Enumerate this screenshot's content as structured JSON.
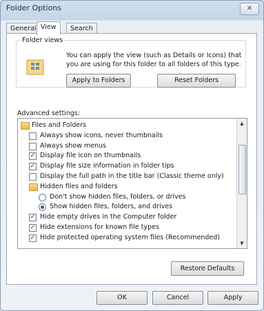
{
  "window": {
    "title": "Folder Options",
    "close_glyph": "✕"
  },
  "tabs": [
    {
      "label": "General"
    },
    {
      "label": "View"
    },
    {
      "label": "Search"
    }
  ],
  "folder_views": {
    "legend": "Folder views",
    "description": "You can apply the view (such as Details or Icons) that you are using for this folder to all folders of this type.",
    "apply_button": "Apply to Folders",
    "reset_button": "Reset Folders"
  },
  "advanced": {
    "label": "Advanced settings:",
    "items": [
      {
        "type": "folder",
        "label": "Files and Folders",
        "level": 0
      },
      {
        "type": "checkbox",
        "label": "Always show icons, never thumbnails",
        "checked": false,
        "level": 1
      },
      {
        "type": "checkbox",
        "label": "Always show menus",
        "checked": false,
        "level": 1
      },
      {
        "type": "checkbox",
        "label": "Display file icon on thumbnails",
        "checked": true,
        "level": 1
      },
      {
        "type": "checkbox",
        "label": "Display file size information in folder tips",
        "checked": true,
        "level": 1
      },
      {
        "type": "checkbox",
        "label": "Display the full path in the title bar (Classic theme only)",
        "checked": false,
        "level": 1
      },
      {
        "type": "folder",
        "label": "Hidden files and folders",
        "level": 1
      },
      {
        "type": "radio",
        "label": "Don't show hidden files, folders, or drives",
        "checked": false,
        "level": 2
      },
      {
        "type": "radio",
        "label": "Show hidden files, folders, and drives",
        "checked": true,
        "level": 2
      },
      {
        "type": "checkbox",
        "label": "Hide empty drives in the Computer folder",
        "checked": true,
        "level": 1
      },
      {
        "type": "checkbox",
        "label": "Hide extensions for known file types",
        "checked": true,
        "level": 1
      },
      {
        "type": "checkbox",
        "label": "Hide protected operating system files (Recommended)",
        "checked": true,
        "level": 1
      }
    ],
    "restore_button": "Restore Defaults",
    "scroll_up_glyph": "▲",
    "scroll_down_glyph": "▼"
  },
  "footer": {
    "ok": "OK",
    "cancel": "Cancel",
    "apply": "Apply"
  },
  "icons": {
    "close": "close-icon",
    "folder_view": "folder-view-icon",
    "folder": "folder-icon"
  },
  "colors": {
    "title_bar": "#c4d6e8",
    "panel_bg": "#ffffff",
    "window_bg": "#eef2f6",
    "check_mark": "#233333",
    "radio_dot": "#2c5b8f"
  }
}
